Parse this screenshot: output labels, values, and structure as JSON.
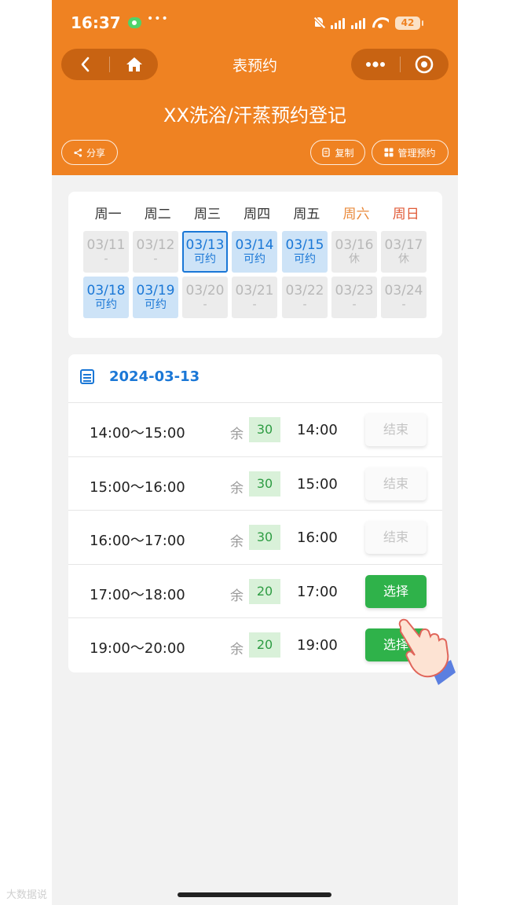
{
  "status_bar": {
    "time": "16:37",
    "notif_dots": "•••",
    "battery": "42"
  },
  "nav": {
    "title": "表预约",
    "back_icon": "chevron-left-icon",
    "home_icon": "home-icon",
    "more_icon": "more-dots-icon",
    "target_icon": "target-icon"
  },
  "header": {
    "page_title": "XX洗浴/汗蒸预约登记",
    "share_label": "分享",
    "copy_label": "复制",
    "manage_label": "管理预约"
  },
  "calendar": {
    "weekdays": [
      "周一",
      "周二",
      "周三",
      "周四",
      "周五",
      "周六",
      "周日"
    ],
    "days": [
      {
        "date": "03/11",
        "status": "-",
        "state": "off"
      },
      {
        "date": "03/12",
        "status": "-",
        "state": "off"
      },
      {
        "date": "03/13",
        "status": "可约",
        "state": "selected"
      },
      {
        "date": "03/14",
        "status": "可约",
        "state": "available"
      },
      {
        "date": "03/15",
        "status": "可约",
        "state": "available"
      },
      {
        "date": "03/16",
        "status": "休",
        "state": "off"
      },
      {
        "date": "03/17",
        "status": "休",
        "state": "off"
      },
      {
        "date": "03/18",
        "status": "可约",
        "state": "available"
      },
      {
        "date": "03/19",
        "status": "可约",
        "state": "available"
      },
      {
        "date": "03/20",
        "status": "-",
        "state": "off"
      },
      {
        "date": "03/21",
        "status": "-",
        "state": "off"
      },
      {
        "date": "03/22",
        "status": "-",
        "state": "off"
      },
      {
        "date": "03/23",
        "status": "-",
        "state": "off"
      },
      {
        "date": "03/24",
        "status": "-",
        "state": "off"
      }
    ]
  },
  "slots": {
    "date": "2024-03-13",
    "remain_label": "余",
    "rows": [
      {
        "range": "14:00～15:00",
        "remain": "30",
        "start": "14:00",
        "button": "结束",
        "state": "ended"
      },
      {
        "range": "15:00～16:00",
        "remain": "30",
        "start": "15:00",
        "button": "结束",
        "state": "ended"
      },
      {
        "range": "16:00～17:00",
        "remain": "30",
        "start": "16:00",
        "button": "结束",
        "state": "ended"
      },
      {
        "range": "17:00～18:00",
        "remain": "20",
        "start": "17:00",
        "button": "选择",
        "state": "open"
      },
      {
        "range": "19:00～20:00",
        "remain": "20",
        "start": "19:00",
        "button": "选择",
        "state": "open"
      }
    ]
  },
  "watermark": "大数据说"
}
